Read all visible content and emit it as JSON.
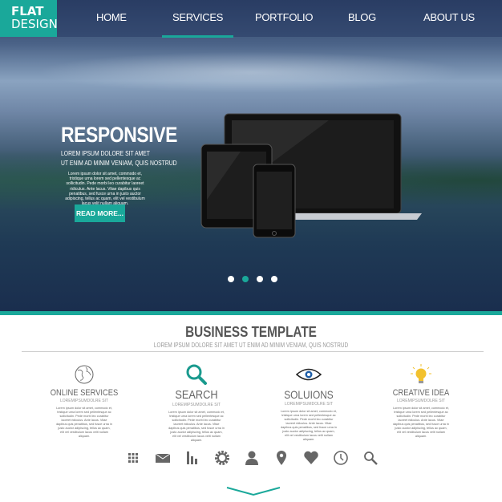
{
  "logo": {
    "line1": "FLAT",
    "line2": "DESIGN"
  },
  "nav": {
    "items": [
      {
        "label": "HOME"
      },
      {
        "label": "SERVICES",
        "active": true
      },
      {
        "label": "PORTFOLIO"
      },
      {
        "label": "BLOG"
      },
      {
        "label": "ABOUT US"
      }
    ]
  },
  "hero": {
    "title": "RESPONSIVE",
    "subtitle1": "LOREM IPSUM DOLORE SIT AMET",
    "subtitle2": "UT ENIM AD MINIM VENIAM, QUIS NOSTRUD",
    "body": "Lorem ipsum dolor sit amet, commodo et, tristique urna lorem sed pellentesque ac sollicitudin. Pede morbi leo curabitur laoreet ridiculus. Ante lacus. Vitae dapibus quis penatibus, sed fusce urna in justo auctor adipiscing, tellus ac quam, elit vel vestibulum lacus velit nullam aliquam.",
    "button": "READ MORE...",
    "slides": 4,
    "active_slide": 2
  },
  "section": {
    "title": "BUSINESS TEMPLATE",
    "subtitle": "LOREM IPSUM DOLORE SIT AMET UT ENIM AD MINIM VENIAM, QUIS NOSTRUD"
  },
  "features": [
    {
      "icon": "globe-icon",
      "title": "ONLINE SERVICES",
      "sub": "LOREMIPSUMDOLRE SIT",
      "body": "Lorem ipsum dolor sit amet, commodo et, tristique urna lorem sed pellentesque ac sollicitudin. Pede morbi leo curabitur laoreet ridiculus. Ante lacus. Vitae dapibus quis penatibus, sed fusce urna in justo auctor adipiscing, tellus ac quam, elit vel vestibulum lacus velit nullam aliquam."
    },
    {
      "icon": "magnifier-icon",
      "title": "SEARCH",
      "sub": "LOREMIPSUMDOLRE SIT",
      "body": "Lorem ipsum dolor sit amet, commodo et, tristique urna lorem sed pellentesque ac sollicitudin. Pede morbi leo curabitur laoreet ridiculus. Ante lacus. Vitae dapibus quis penatibus, sed fusce urna in justo auctor adipiscing, tellus ac quam, elit vel vestibulum lacus velit nullam aliquam."
    },
    {
      "icon": "eye-icon",
      "title": "SOLUIONS",
      "sub": "LOREMIPSUMDOLRE SIT",
      "body": "Lorem ipsum dolor sit amet, commodo et, tristique urna lorem sed pellentesque ac sollicitudin. Pede morbi leo curabitur laoreet ridiculus. Ante lacus. Vitae dapibus quis penatibus, sed fusce urna in justo auctor adipiscing, tellus ac quam, elit vel vestibulum lacus velit nullam aliquam."
    },
    {
      "icon": "lightbulb-icon",
      "title": "CREATIVE IDEA",
      "sub": "LOREMIPSUMDOLRE SIT",
      "body": "Lorem ipsum dolor sit amet, commodo et, tristique urna lorem sed pellentesque ac sollicitudin. Pede morbi leo curabitur laoreet ridiculus. Ante lacus. Vitae dapibus quis penatibus, sed fusce urna in justo auctor adipiscing, tellus ac quam, elit vel vestibulum lacus velit nullam aliquam."
    }
  ],
  "icon_row": [
    "grid-icon",
    "mail-icon",
    "bar-chart-icon",
    "gear-icon",
    "user-icon",
    "location-pin-icon",
    "heart-icon",
    "clock-icon",
    "search-icon"
  ],
  "colors": {
    "accent": "#1aa89a",
    "text": "#555555",
    "icon": "#666666",
    "bulb": "#f2c12e"
  }
}
